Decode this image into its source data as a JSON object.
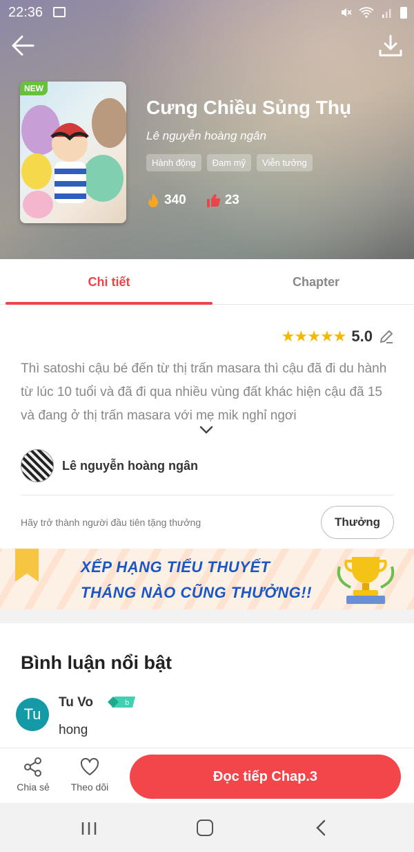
{
  "status_bar": {
    "time": "22:36"
  },
  "book": {
    "title": "Cưng Chiều Sủng Thụ",
    "author": "Lê nguyễn hoàng ngân",
    "badge": "NEW",
    "tags": [
      "Hành động",
      "Đam mỹ",
      "Viễn tưởng"
    ],
    "views": "340",
    "likes": "23"
  },
  "tabs": {
    "detail": "Chi tiết",
    "chapter": "Chapter"
  },
  "rating": {
    "stars": "★★★★★",
    "value": "5.0"
  },
  "description": "Thì satoshi cậu bé đến từ thị trấn masara thì cậu đã đi du hành từ lúc 10 tuổi và đã đi qua nhiều vùng đất khác hiện cậu đã 15 và đang ở thị trấn masara với mẹ mik nghỉ ngơi",
  "uploader": {
    "name": "Lê nguyễn hoàng ngân"
  },
  "reward": {
    "prompt": "Hãy trở thành người đầu tiên tặng thưởng",
    "button": "Thưởng"
  },
  "banner": {
    "line1": "XẾP HẠNG TIỂU THUYẾT",
    "line2": "THÁNG NÀO CŨNG THƯỞNG!!"
  },
  "comments": {
    "title": "Bình luận nổi bật",
    "items": [
      {
        "avatar_initials": "Tu",
        "name": "Tu Vo",
        "text": "hong"
      }
    ]
  },
  "bottom_bar": {
    "share": "Chia sẻ",
    "follow": "Theo dõi",
    "read": "Đọc tiếp Chap.3"
  },
  "colors": {
    "accent": "#e8464a",
    "banner_text": "#1a56c4",
    "star": "#f5b800"
  }
}
